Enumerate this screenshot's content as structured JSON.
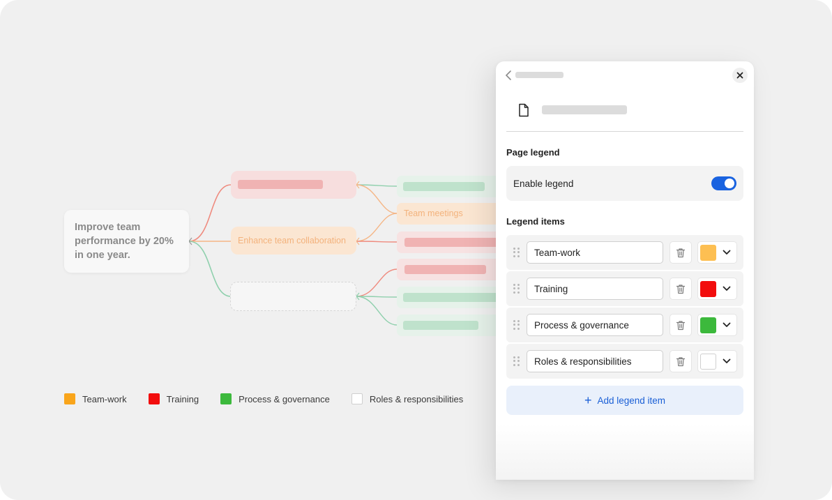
{
  "mindmap": {
    "root_text": "Improve team performance by 20% in one year.",
    "enhance_label": "Enhance team collaboration",
    "meetings_label": "Team meetings"
  },
  "legend": {
    "items": [
      {
        "label": "Team-work",
        "color": "#f9a51b"
      },
      {
        "label": "Training",
        "color": "#f20d0d"
      },
      {
        "label": "Process & governance",
        "color": "#3cb93c"
      },
      {
        "label": "Roles & responsibilities",
        "color": "#ffffff"
      }
    ]
  },
  "panel": {
    "page_legend_title": "Page legend",
    "enable_legend_label": "Enable legend",
    "enable_legend_on": true,
    "legend_items_title": "Legend items",
    "items": [
      {
        "value": "Team-work",
        "color": "#fdbf52"
      },
      {
        "value": "Training",
        "color": "#f20d0d"
      },
      {
        "value": "Process & governance",
        "color": "#3cb93c"
      },
      {
        "value": "Roles & responsibilities",
        "color": "#ffffff"
      }
    ],
    "add_item_label": "Add legend item",
    "colors": {
      "accent": "#1a63e0",
      "add_text": "#1a5fd6"
    }
  }
}
